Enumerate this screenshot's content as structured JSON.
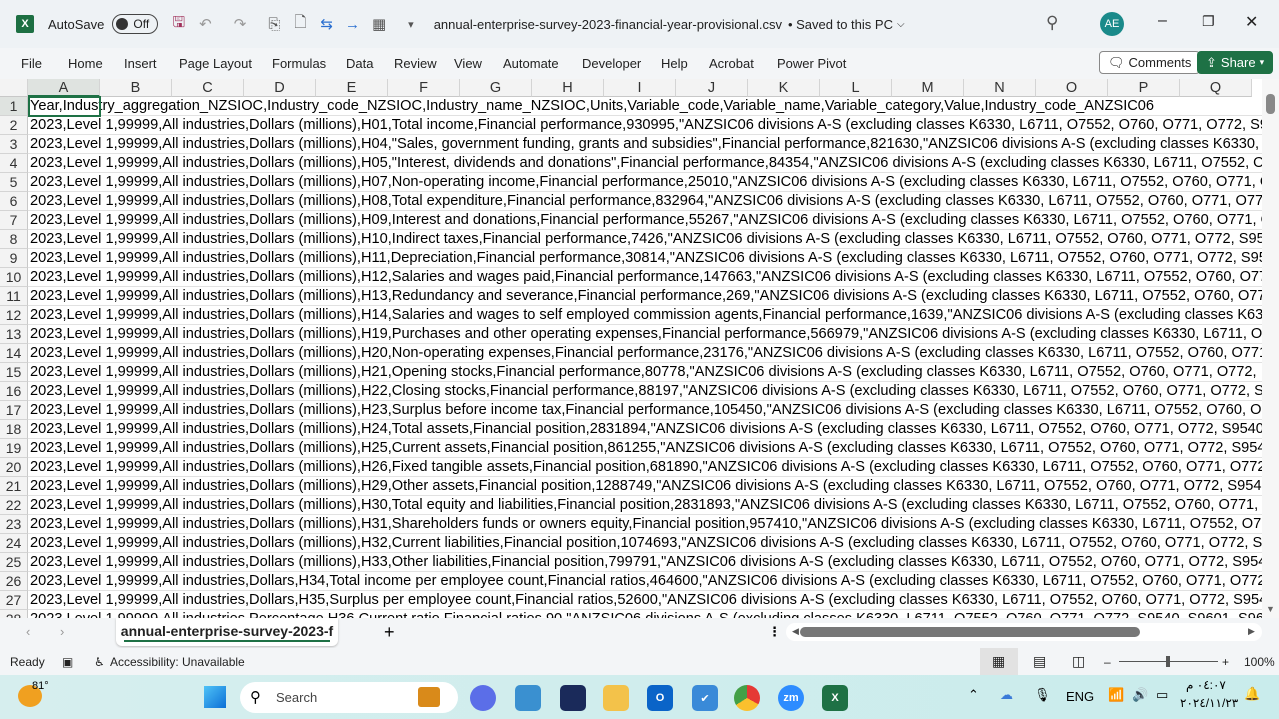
{
  "titlebar": {
    "autosave_label": "AutoSave",
    "autosave_state": "Off",
    "filename": "annual-enterprise-survey-2023-financial-year-provisional.csv",
    "save_status": "• Saved to this PC",
    "user_initials": "AE"
  },
  "ribbon": {
    "tabs": [
      "File",
      "Home",
      "Insert",
      "Page Layout",
      "Formulas",
      "Data",
      "Review",
      "View",
      "Automate",
      "Developer",
      "Help",
      "Acrobat",
      "Power Pivot"
    ],
    "comments_label": "Comments",
    "share_label": "Share"
  },
  "grid": {
    "columns": [
      "A",
      "B",
      "C",
      "D",
      "E",
      "F",
      "G",
      "H",
      "I",
      "J",
      "K",
      "L",
      "M",
      "N",
      "O",
      "P",
      "Q"
    ],
    "rows": [
      "Year,Industry_aggregation_NZSIOC,Industry_code_NZSIOC,Industry_name_NZSIOC,Units,Variable_code,Variable_name,Variable_category,Value,Industry_code_ANZSIC06",
      "2023,Level 1,99999,All industries,Dollars (millions),H01,Total income,Financial performance,930995,\"ANZSIC06 divisions A-S (excluding classes K6330, L6711, O7552, O760, O771, O772, S9540",
      "2023,Level 1,99999,All industries,Dollars (millions),H04,\"Sales, government funding, grants and subsidies\",Financial performance,821630,\"ANZSIC06 divisions A-S (excluding classes K6330, L6711",
      "2023,Level 1,99999,All industries,Dollars (millions),H05,\"Interest, dividends and donations\",Financial performance,84354,\"ANZSIC06 divisions A-S (excluding classes K6330, L6711, O7552, O760",
      "2023,Level 1,99999,All industries,Dollars (millions),H07,Non-operating income,Financial performance,25010,\"ANZSIC06 divisions A-S (excluding classes K6330, L6711, O7552, O760, O771, O772",
      "2023,Level 1,99999,All industries,Dollars (millions),H08,Total expenditure,Financial performance,832964,\"ANZSIC06 divisions A-S (excluding classes K6330, L6711, O7552, O760, O771, O772",
      "2023,Level 1,99999,All industries,Dollars (millions),H09,Interest and donations,Financial performance,55267,\"ANZSIC06 divisions A-S (excluding classes K6330, L6711, O7552, O760, O771, O772",
      "2023,Level 1,99999,All industries,Dollars (millions),H10,Indirect taxes,Financial performance,7426,\"ANZSIC06 divisions A-S (excluding classes K6330, L6711, O7552, O760, O771, O772, S9540",
      "2023,Level 1,99999,All industries,Dollars (millions),H11,Depreciation,Financial performance,30814,\"ANZSIC06 divisions A-S (excluding classes K6330, L6711, O7552, O760, O771, O772, S9540",
      "2023,Level 1,99999,All industries,Dollars (millions),H12,Salaries and wages paid,Financial performance,147663,\"ANZSIC06 divisions A-S (excluding classes K6330, L6711, O7552, O760, O771",
      "2023,Level 1,99999,All industries,Dollars (millions),H13,Redundancy and severance,Financial performance,269,\"ANZSIC06 divisions A-S (excluding classes K6330, L6711, O7552, O760, O771",
      "2023,Level 1,99999,All industries,Dollars (millions),H14,Salaries and wages to self employed commission agents,Financial performance,1639,\"ANZSIC06 divisions A-S (excluding classes K6330",
      "2023,Level 1,99999,All industries,Dollars (millions),H19,Purchases and other operating expenses,Financial performance,566979,\"ANZSIC06 divisions A-S (excluding classes K6330, L6711, O7552",
      "2023,Level 1,99999,All industries,Dollars (millions),H20,Non-operating expenses,Financial performance,23176,\"ANZSIC06 divisions A-S (excluding classes K6330, L6711, O7552, O760, O771",
      "2023,Level 1,99999,All industries,Dollars (millions),H21,Opening stocks,Financial performance,80778,\"ANZSIC06 divisions A-S (excluding classes K6330, L6711, O7552, O760, O771, O772,",
      "2023,Level 1,99999,All industries,Dollars (millions),H22,Closing stocks,Financial performance,88197,\"ANZSIC06 divisions A-S (excluding classes K6330, L6711, O7552, O760, O771, O772, S9540",
      "2023,Level 1,99999,All industries,Dollars (millions),H23,Surplus before income tax,Financial performance,105450,\"ANZSIC06 divisions A-S (excluding classes K6330, L6711, O7552, O760, O771",
      "2023,Level 1,99999,All industries,Dollars (millions),H24,Total assets,Financial position,2831894,\"ANZSIC06 divisions A-S (excluding classes K6330, L6711, O7552, O760, O771, O772, S9540",
      "2023,Level 1,99999,All industries,Dollars (millions),H25,Current assets,Financial position,861255,\"ANZSIC06 divisions A-S (excluding classes K6330, L6711, O7552, O760, O771, O772, S9540",
      "2023,Level 1,99999,All industries,Dollars (millions),H26,Fixed tangible assets,Financial position,681890,\"ANZSIC06 divisions A-S (excluding classes K6330, L6711, O7552, O760, O771, O772",
      "2023,Level 1,99999,All industries,Dollars (millions),H29,Other assets,Financial position,1288749,\"ANZSIC06 divisions A-S (excluding classes K6330, L6711, O7552, O760, O771, O772, S9540",
      "2023,Level 1,99999,All industries,Dollars (millions),H30,Total equity and liabilities,Financial position,2831893,\"ANZSIC06 divisions A-S (excluding classes K6330, L6711, O7552, O760, O771, O772",
      "2023,Level 1,99999,All industries,Dollars (millions),H31,Shareholders funds or owners equity,Financial position,957410,\"ANZSIC06 divisions A-S (excluding classes K6330, L6711, O7552, O760",
      "2023,Level 1,99999,All industries,Dollars (millions),H32,Current liabilities,Financial position,1074693,\"ANZSIC06 divisions A-S (excluding classes K6330, L6711, O7552, O760, O771, O772, S9540",
      "2023,Level 1,99999,All industries,Dollars (millions),H33,Other liabilities,Financial position,799791,\"ANZSIC06 divisions A-S (excluding classes K6330, L6711, O7552, O760, O771, O772, S9540",
      "2023,Level 1,99999,All industries,Dollars,H34,Total income per employee count,Financial ratios,464600,\"ANZSIC06 divisions A-S (excluding classes K6330, L6711, O7552, O760, O771, O772, S9540",
      "2023,Level 1,99999,All industries,Dollars,H35,Surplus per employee count,Financial ratios,52600,\"ANZSIC06 divisions A-S (excluding classes K6330, L6711, O7552, O760, O771, O772, S9540",
      "2023,Level 1,99999,All industries,Percentage,H36,Current ratio,Financial ratios,90,\"ANZSIC06 divisions A-S (excluding classes K6330, L6711, O7552, O760, O771, O772, S9540, S9601, S96"
    ]
  },
  "sheets": {
    "active": "annual-enterprise-survey-2023-f",
    "add_label": "+"
  },
  "status": {
    "ready": "Ready",
    "accessibility": "Accessibility: Unavailable",
    "zoom": "100%",
    "zoom_level_percent": 100
  },
  "taskbar": {
    "weather": "81°",
    "search_placeholder": "Search",
    "lang": "ENG",
    "time": "٠٤:٠٧ م",
    "date": "٢٠٢٤/١١/٢٣"
  },
  "colors": {
    "excel_green": "#1e7145",
    "avatar": "#1a8a8a"
  }
}
